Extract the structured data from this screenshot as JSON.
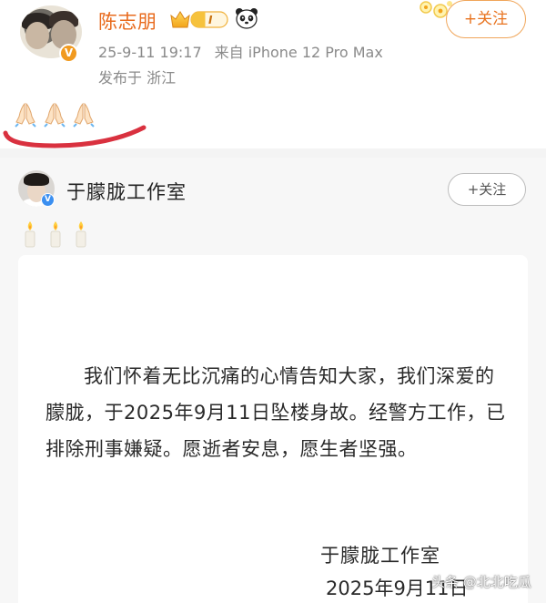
{
  "post": {
    "username": "陈志朋",
    "vip_level_label": "I",
    "timestamp": "25-9-11 19:17",
    "source": "来自 iPhone 12 Pro Max",
    "location": "发布于 浙江",
    "follow_label": "+关注",
    "emojis": [
      "pray-icon",
      "pray-icon",
      "pray-icon"
    ],
    "verified_badge": "V"
  },
  "repost": {
    "username": "于朦胧工作室",
    "follow_label": "+关注",
    "verified_badge": "V",
    "emojis": [
      "candle-icon",
      "candle-icon",
      "candle-icon"
    ],
    "statement": {
      "body": "我们怀着无比沉痛的心情告知大家，我们深爱的朦胧，于2025年9月11日坠楼身故。经警方工作，已排除刑事嫌疑。愿逝者安息，愿生者坚强。",
      "signature_name": "于朦胧工作室",
      "signature_date": "2025年9月11日"
    }
  },
  "watermark": "头条 @北北吃瓜",
  "colors": {
    "username_orange": "#e86b1e",
    "follow_orange": "#e8731f",
    "meta_gray": "#8a8a8a",
    "verified_blue": "#3b8ff0",
    "verified_orange": "#f19a1f",
    "annotation_red": "#d9313f"
  }
}
